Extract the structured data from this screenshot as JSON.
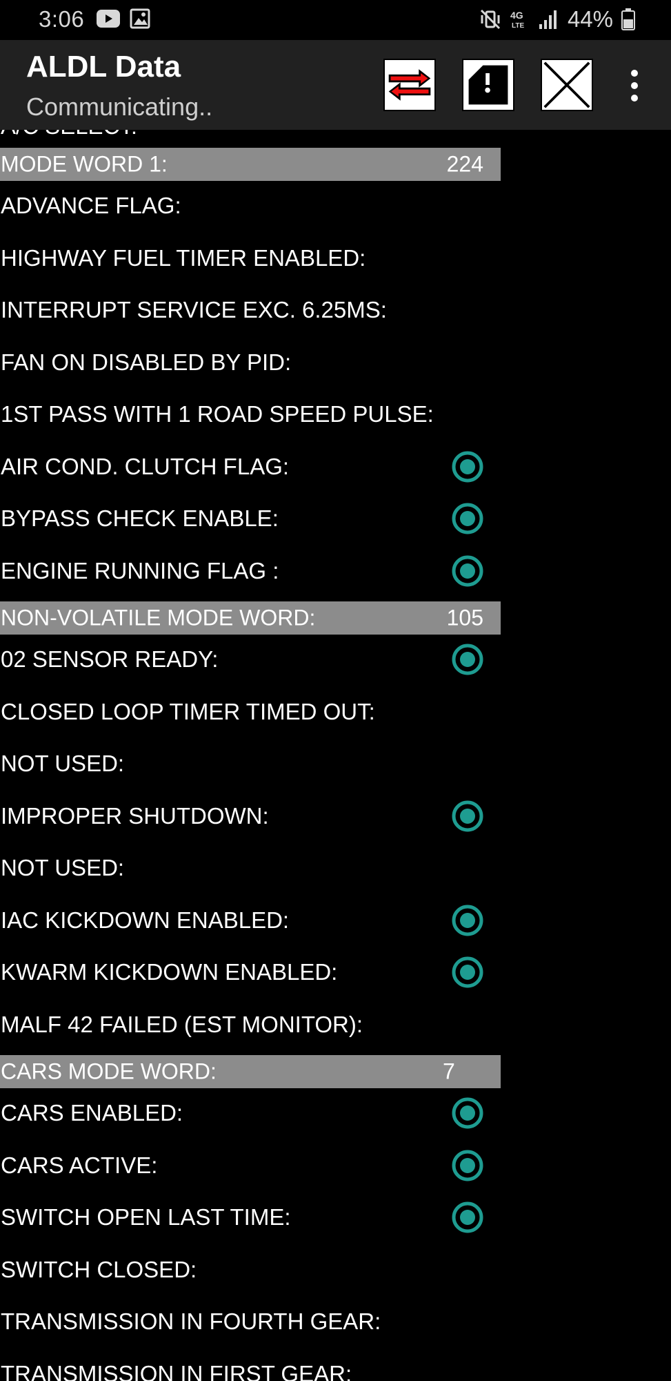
{
  "status_bar": {
    "time": "3:06",
    "network_label": "4G LTE",
    "battery": "44%"
  },
  "app_bar": {
    "title": "ALDL Data",
    "subtitle": "Communicating.."
  },
  "colors": {
    "indicator": "#1e9c91",
    "header_bg": "#8c8c8c",
    "app_bar_bg": "#212121",
    "background": "#000000"
  },
  "content": {
    "partial_top_label": "A/C SELECT:",
    "groups": [
      {
        "header": "MODE WORD 1:",
        "value": "224",
        "items": [
          {
            "label": "ADVANCE FLAG:",
            "on": false
          },
          {
            "label": "HIGHWAY FUEL TIMER ENABLED:",
            "on": false
          },
          {
            "label": "INTERRUPT SERVICE EXC. 6.25MS:",
            "on": false
          },
          {
            "label": "FAN ON DISABLED BY PID:",
            "on": false
          },
          {
            "label": "1ST PASS WITH 1 ROAD SPEED PULSE:",
            "on": false
          },
          {
            "label": "AIR COND. CLUTCH FLAG:",
            "on": true
          },
          {
            "label": "BYPASS CHECK ENABLE:",
            "on": true
          },
          {
            "label": "ENGINE RUNNING FLAG :",
            "on": true
          }
        ]
      },
      {
        "header": "NON-VOLATILE MODE WORD:",
        "value": "105",
        "items": [
          {
            "label": "02 SENSOR READY:",
            "on": true
          },
          {
            "label": "CLOSED LOOP TIMER TIMED OUT:",
            "on": false
          },
          {
            "label": "NOT USED:",
            "on": false
          },
          {
            "label": "IMPROPER SHUTDOWN:",
            "on": true
          },
          {
            "label": "NOT USED:",
            "on": false
          },
          {
            "label": "IAC KICKDOWN ENABLED:",
            "on": true
          },
          {
            "label": "KWARM KICKDOWN ENABLED:",
            "on": true
          },
          {
            "label": "MALF 42 FAILED (EST MONITOR):",
            "on": false
          }
        ]
      },
      {
        "header": "CARS MODE WORD:",
        "value": "7",
        "items": [
          {
            "label": "CARS ENABLED:",
            "on": true
          },
          {
            "label": "CARS ACTIVE:",
            "on": true
          },
          {
            "label": "SWITCH OPEN LAST TIME:",
            "on": true
          },
          {
            "label": "SWITCH CLOSED:",
            "on": false
          },
          {
            "label": "TRANSMISSION IN FOURTH GEAR:",
            "on": false
          },
          {
            "label": "TRANSMISSION IN FIRST GEAR:",
            "on": false
          }
        ]
      }
    ]
  }
}
